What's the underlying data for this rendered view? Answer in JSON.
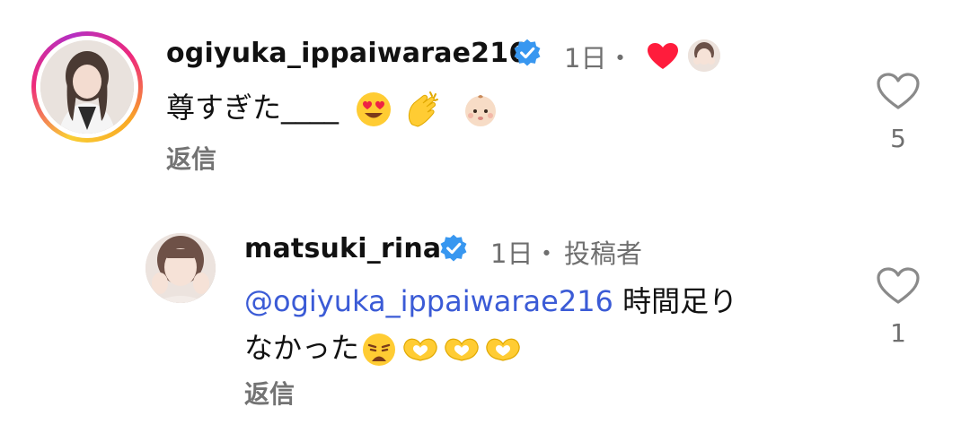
{
  "comments": [
    {
      "username": "ogiyuka_ippaiwarae216",
      "time": "1日",
      "separator": "・",
      "text_lead": "尊すぎた",
      "text_tail": "____",
      "reply_label": "返信",
      "like_count": "5",
      "emojis": [
        "heart-eyes-emoji",
        "clapping-hands-emoji",
        "baby-face-emoji"
      ],
      "liked_by_author": true
    },
    {
      "username": "matsuki_rina",
      "time": "1日",
      "separator": "・",
      "author_badge": "投稿者",
      "mention": "@ogiyuka_ippaiwarae216",
      "text_line1": " 時間足り",
      "text_line2": "なかった",
      "reply_label": "返信",
      "like_count": "1",
      "emojis": [
        "weary-face-emoji",
        "heart-hands-emoji",
        "heart-hands-emoji",
        "heart-hands-emoji"
      ]
    }
  ],
  "colors": {
    "verified_blue": "#3897f0",
    "mention_blue": "#3b5bd6",
    "like_heart_red": "#ff1c3c",
    "muted_text": "#737373"
  }
}
